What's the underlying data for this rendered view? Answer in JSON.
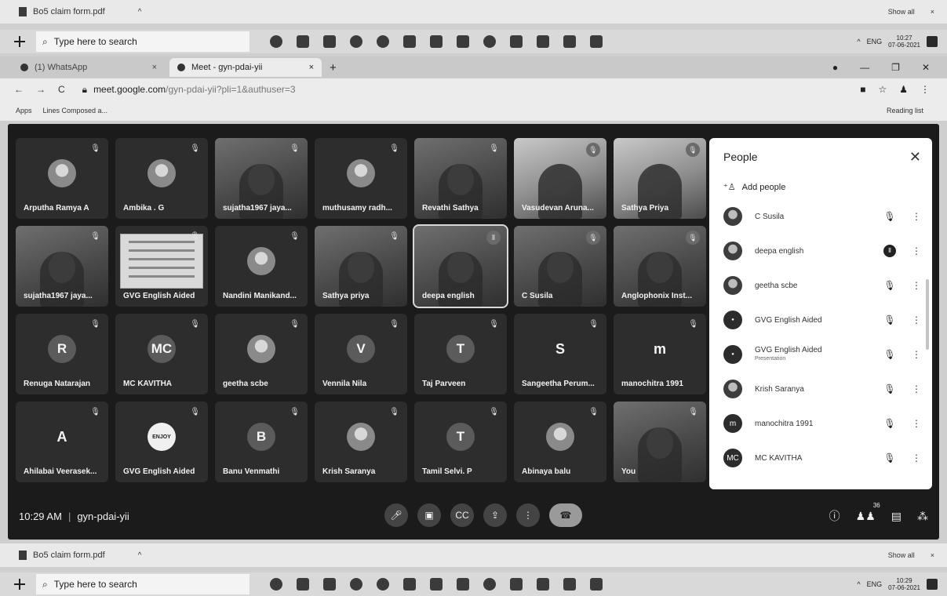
{
  "top_download_bar": {
    "file_name": "Bo5 claim form.pdf",
    "show_all": "Show all",
    "close": "×"
  },
  "top_taskbar": {
    "search_placeholder": "Type here to search",
    "time": "10:27",
    "date": "07-06-2021",
    "lang": "ENG"
  },
  "browser": {
    "tabs": [
      {
        "label": "(1) WhatsApp",
        "close": "×"
      },
      {
        "label": "Meet - gyn-pdai-yii",
        "close": "×"
      }
    ],
    "new_tab": "+",
    "url_domain": "meet.google.com",
    "url_path": "/gyn-pdai-yii?pli=1&authuser=3",
    "bookmarks": [
      "Apps",
      "Lines Composed a..."
    ],
    "reading_list": "Reading list"
  },
  "meet": {
    "time": "10:29 AM",
    "separator": "|",
    "code": "gyn-pdai-yii",
    "participants_count": "36",
    "tiles": [
      {
        "name": "Arputha Ramya A",
        "kind": "photo-avatar"
      },
      {
        "name": "Ambika . G",
        "kind": "photo-avatar"
      },
      {
        "name": "sujatha1967 jaya...",
        "kind": "video"
      },
      {
        "name": "muthusamy radh...",
        "kind": "photo-avatar"
      },
      {
        "name": "Revathi Sathya",
        "kind": "video"
      },
      {
        "name": "Vasudevan Aruna...",
        "kind": "video-light"
      },
      {
        "name": "Sathya Priya",
        "kind": "video-light"
      },
      {
        "name": "sujatha1967 jaya...",
        "kind": "video"
      },
      {
        "name": "GVG English Aided",
        "kind": "slide"
      },
      {
        "name": "Nandini Manikand...",
        "kind": "photo-avatar"
      },
      {
        "name": "Sathya priya",
        "kind": "video"
      },
      {
        "name": "deepa english",
        "kind": "video-active"
      },
      {
        "name": "C Susila",
        "kind": "video"
      },
      {
        "name": "Anglophonix Inst...",
        "kind": "video"
      },
      {
        "name": "Renuga Natarajan",
        "kind": "letter",
        "initial": "R"
      },
      {
        "name": "MC KAVITHA",
        "kind": "letter",
        "initial": "MC"
      },
      {
        "name": "geetha scbe",
        "kind": "photo-avatar"
      },
      {
        "name": "Vennila Nila",
        "kind": "letter",
        "initial": "V"
      },
      {
        "name": "Taj Parveen",
        "kind": "letter",
        "initial": "T"
      },
      {
        "name": "Sangeetha Perum...",
        "kind": "letter-plain",
        "initial": "S"
      },
      {
        "name": "manochitra 1991",
        "kind": "letter-plain",
        "initial": "m"
      },
      {
        "name": "Ahilabai Veerasek...",
        "kind": "letter-plain",
        "initial": "A"
      },
      {
        "name": "GVG English Aided",
        "kind": "logo",
        "initial": "ENJOY"
      },
      {
        "name": "Banu Venmathi",
        "kind": "letter",
        "initial": "B"
      },
      {
        "name": "Krish Saranya",
        "kind": "photo-avatar"
      },
      {
        "name": "Tamil Selvi. P",
        "kind": "letter",
        "initial": "T"
      },
      {
        "name": "Abinaya balu",
        "kind": "photo-avatar"
      },
      {
        "name": "You",
        "kind": "video"
      }
    ],
    "people_panel": {
      "title": "People",
      "add_people": "Add people",
      "list": [
        {
          "name": "C Susila",
          "sub": "",
          "mic": "muted",
          "avatar": "photo"
        },
        {
          "name": "deepa english",
          "sub": "",
          "mic": "speaking",
          "avatar": "photo"
        },
        {
          "name": "geetha scbe",
          "sub": "",
          "mic": "muted",
          "avatar": "photo"
        },
        {
          "name": "GVG English Aided",
          "sub": "",
          "mic": "muted",
          "avatar": "logo"
        },
        {
          "name": "GVG English Aided",
          "sub": "Presentation",
          "mic": "muted",
          "avatar": "logo"
        },
        {
          "name": "Krish Saranya",
          "sub": "",
          "mic": "muted",
          "avatar": "photo"
        },
        {
          "name": "manochitra 1991",
          "sub": "",
          "mic": "muted",
          "avatar": "m"
        },
        {
          "name": "MC KAVITHA",
          "sub": "",
          "mic": "muted",
          "avatar": "MC"
        }
      ]
    }
  },
  "bottom_download_bar": {
    "file_name": "Bo5 claim form.pdf",
    "show_all": "Show all",
    "close": "×"
  },
  "bottom_taskbar": {
    "search_placeholder": "Type here to search",
    "time": "10:29",
    "date": "07-06-2021",
    "lang": "ENG"
  }
}
